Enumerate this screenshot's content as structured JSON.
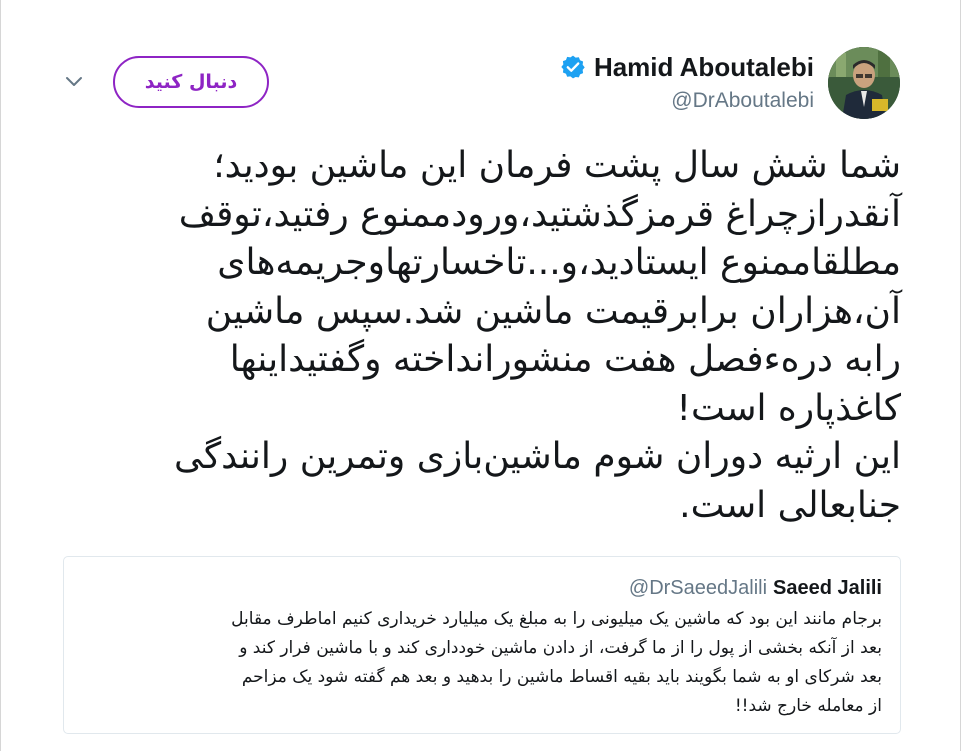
{
  "author": {
    "display_name": "Hamid Aboutalebi",
    "handle": "@DrAboutalebi",
    "verified": true,
    "verified_icon": "verified-badge-icon",
    "verified_color": "#1da1f2"
  },
  "follow_button": {
    "label": "دنبال کنید",
    "color": "#8e24c4"
  },
  "menu": {
    "icon": "chevron-down-icon"
  },
  "tweet": {
    "lines": [
      "شما شش سال پشت فرمان این ماشین بودید؛",
      "آنقدرازچراغ قرمزگذشتید،ورودممنوع رفتید،توقف",
      "مطلقاممنوع ایستادید،و...تاخسارتهاوجریمه‌های",
      "آن،هزاران برابرقیمت ماشین شد.سپس ماشین",
      "رابه دره‌ءفصل هفت منشورانداخته وگفتیداینها",
      "کاغذپاره است!",
      "این ارثیه دوران شوم ماشین‌بازی وتمرین رانندگی",
      "جنابعالی است."
    ]
  },
  "quoted_tweet": {
    "display_name": "Saeed Jalili",
    "handle": "@DrSaeedJalili",
    "lines": [
      "برجام مانند این بود که ماشین یک میلیونی را به مبلغ یک میلیارد خریداری کنیم اماطرف مقابل",
      "بعد از آنکه بخشی از پول را از ما گرفت، از دادن ماشین خودداری کند و با ماشین فرار کند و",
      "بعد شرکای او به شما بگویند باید بقیه اقساط ماشین را بدهید و بعد هم گفته شود یک مزاحم",
      "از معامله خارج شد!!"
    ]
  },
  "colors": {
    "text": "#14171a",
    "secondary": "#657786",
    "border": "#e1e8ed"
  }
}
